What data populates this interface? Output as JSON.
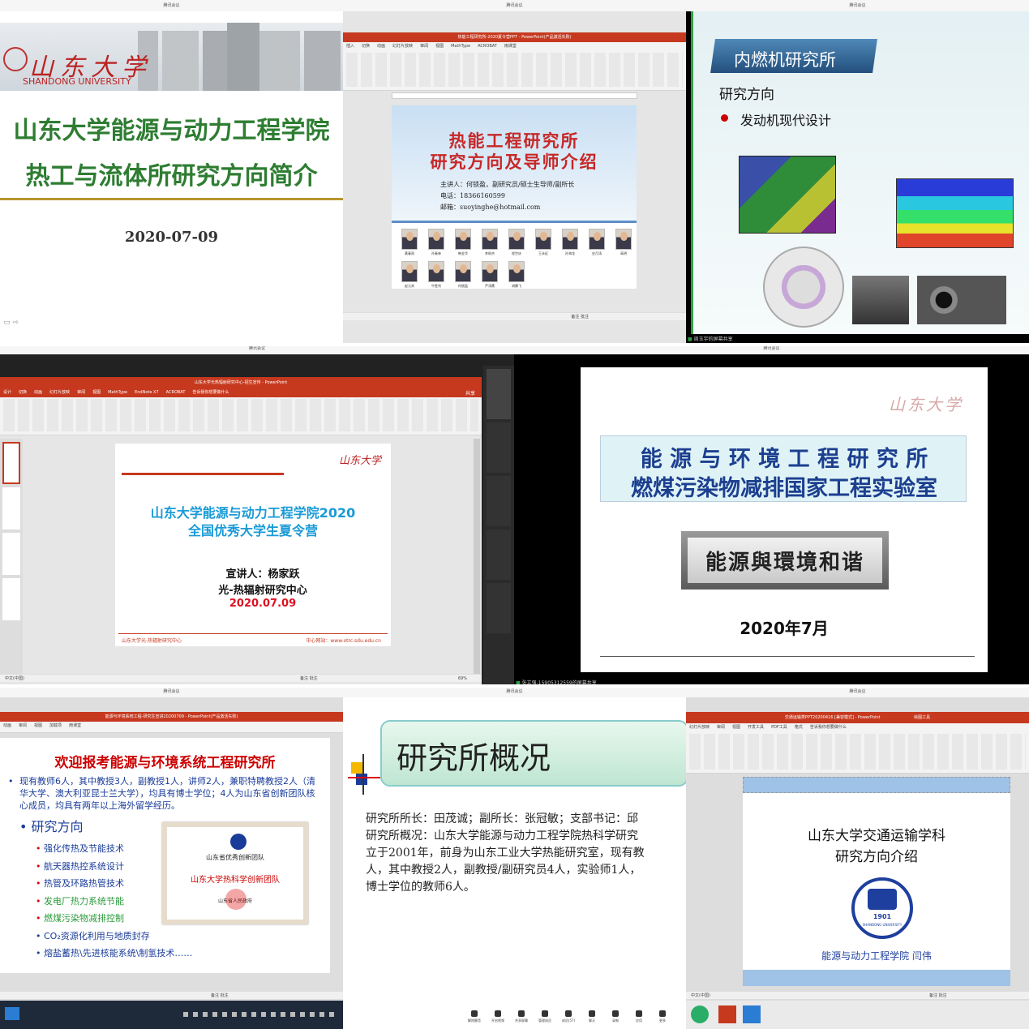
{
  "window_title": "腾讯会议",
  "tiles": {
    "t1": {
      "logo_cn": "山东大学",
      "logo_en": "SHANDONG UNIVERSITY",
      "title1": "山东大学能源与动力工程学院",
      "title2": "热工与流体所研究方向简介",
      "date": "2020-07-09"
    },
    "t2": {
      "app_title": "热能工程研究所-2020夏令营PPT - PowerPoint(产品激活失败)",
      "tabs": [
        "插入",
        "切换",
        "动画",
        "幻灯片放映",
        "审阅",
        "视图",
        "MathType",
        "ACROBAT",
        "雨课堂"
      ],
      "slide_title1": "热能工程研究所",
      "slide_title2": "研究方向及导师介绍",
      "speaker": "主讲人：何锁盈，副研究员/硕士生导师/副所长",
      "phone": "电话：18366160599",
      "email": "邮箱：suoyinghe@hotmail.com",
      "people_row1": [
        "黄春雨",
        "孙秦林",
        "韩金华",
        "李佩杰",
        "程世庆",
        "王永征",
        "孙海龙",
        "史月涛",
        "高明"
      ],
      "people_row2": [
        "赵元宾",
        "牛胜利",
        "何锁盈",
        "芦涛鹰",
        "胡腾飞"
      ],
      "status": "备注  批注"
    },
    "t3": {
      "banner": "内燃机研究所",
      "heading": "研究方向",
      "bullet": "发动机现代设计",
      "share_label": "周玉宇的屏幕共享"
    },
    "t4": {
      "app_title": "山东大学光热辐射研究中心-招生宣传 - PowerPoint",
      "tabs": [
        "设计",
        "切换",
        "动画",
        "幻灯片放映",
        "审阅",
        "视图",
        "MathType",
        "EndNote X7",
        "ACROBAT",
        "告诉我你想要做什么"
      ],
      "share_btn": "共享",
      "logo": "山东大学",
      "title1": "山东大学能源与动力工程学院2020",
      "title2": "全国优秀大学生夏令营",
      "speaker": "宣讲人：杨家跃",
      "center": "光-热辐射研究中心",
      "date": "2020.07.09",
      "footer_left": "山东大学光-热辐射研究中心",
      "footer_right": "中心网站：www.otrc.sdu.edu.cn",
      "status_left": "中文(中国)",
      "status_right": "备注  批注",
      "zoom": "69%"
    },
    "t5": {
      "logo": "山东大学",
      "title1": "能 源 与 环 境 工 程 研 究 所",
      "title2": "燃煤污染物减排国家工程实验室",
      "plaque": "能源與環境和谐",
      "date": "2020年7月",
      "share_label": "张立强-15905312559的屏幕共享"
    },
    "t7": {
      "app_title": "能源与环境系统工程-研究生宣讲20200709 - PowerPoint(产品激活失败)",
      "tabs": [
        "动画",
        "审阅",
        "视图",
        "加载项",
        "雨课堂"
      ],
      "title": "欢迎报考能源与环境系统工程研究所",
      "intro": "现有教师6人，其中教授3人，副教授1人，讲师2人，兼职特聘教授2人（清华大学、澳大利亚昆士兰大学），均具有博士学位；4人为山东省创新团队核心成员，均具有两年以上海外留学经历。",
      "section": "研究方向",
      "items": [
        "强化传热及节能技术",
        "航天器热控系统设计",
        "热管及环路热管技术",
        "发电厂热力系统节能",
        "燃煤污染物减排控制",
        "CO₂资源化利用与地质封存",
        "熔盐蓄热\\先进核能系统\\制氢技术……"
      ],
      "cert_title": "山东省优秀创新团队",
      "cert_name": "山东大学热科学创新团队",
      "cert_sign": "山东省人民政府",
      "status": "备注  批注"
    },
    "t8": {
      "heading": "研究所概况",
      "line1": "研究所所长：田茂诚；副所长：张冠敏；支部书记：邱",
      "line2": "研究所概况：山东大学能源与动力工程学院热科学研究",
      "line3": "立于2001年，前身为山东工业大学热能研究室，现有教",
      "line4": "人，其中教授2人，副教授/副研究员4人，实验师1人，",
      "line5": "博士学位的教师6人。",
      "toolbar": [
        "解除静音",
        "开启视频",
        "共享屏幕",
        "管理成员",
        "成员(57)",
        "聊天",
        "录制",
        "应用",
        "更多"
      ]
    },
    "t9": {
      "app_title": "交通运输类PPT20200416 [兼容模式] - PowerPoint",
      "tools_title": "绘图工具",
      "tabs": [
        "幻灯片放映",
        "审阅",
        "视图",
        "开发工具",
        "PDF工具",
        "格式",
        "告诉我你想要做什么"
      ],
      "title1": "山东大学交通运输学科",
      "title2": "研究方向介绍",
      "seal_year": "1901",
      "seal_text": "SHANDONG UNIVERSITY",
      "author": "能源与动力工程学院  闫伟",
      "status_left": "中文(中国)",
      "status_right": "备注  批注"
    }
  }
}
